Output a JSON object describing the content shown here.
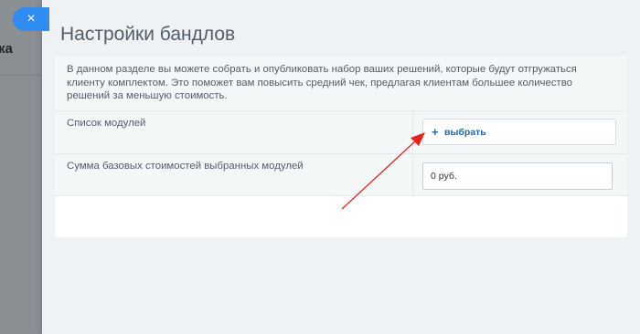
{
  "backdrop": {
    "text": "ка"
  },
  "close_button": {
    "icon": "close-icon",
    "glyph": "×"
  },
  "header": {
    "title": "Настройки бандлов"
  },
  "description": "В данном разделе вы можете собрать и опубликовать набор ваших решений, которые будут отгружаться клиенту комплектом. Это поможет вам повысить средний чек, предлагая клиентам большее количество решений за меньшую стоимость.",
  "modules": {
    "label": "Список модулей",
    "add_icon": "plus-icon",
    "add_glyph": "+",
    "add_label": "выбрать"
  },
  "sum": {
    "label": "Сумма базовых стоимостей выбранных модулей",
    "value": "0 руб."
  },
  "annotation": {
    "arrow_color": "#e0261f"
  }
}
